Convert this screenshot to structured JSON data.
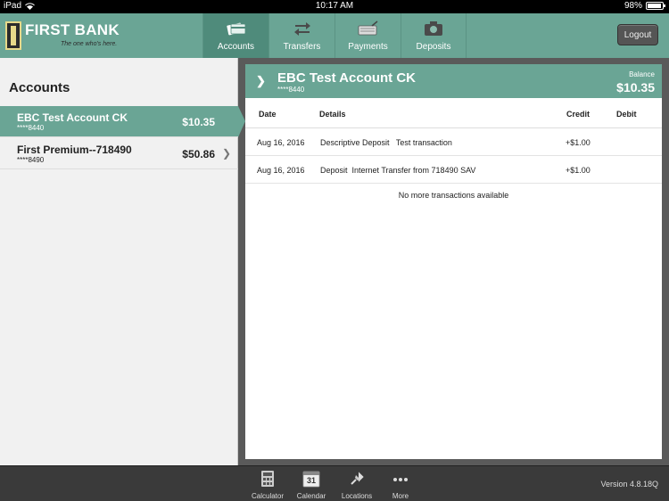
{
  "status_bar": {
    "device": "iPad",
    "time": "10:17 AM",
    "battery": "98%"
  },
  "brand": {
    "name": "FIRST BANK",
    "tagline": "The one who's here."
  },
  "nav": {
    "tabs": [
      {
        "label": "Accounts",
        "icon": "accounts-card-icon",
        "active": true
      },
      {
        "label": "Transfers",
        "icon": "transfer-arrows-icon",
        "active": false
      },
      {
        "label": "Payments",
        "icon": "payments-keyboard-icon",
        "active": false
      },
      {
        "label": "Deposits",
        "icon": "camera-icon",
        "active": false
      }
    ],
    "logout_label": "Logout"
  },
  "accounts_panel": {
    "title": "Accounts",
    "items": [
      {
        "name": "EBC Test Account CK",
        "number": "****8440",
        "balance": "$10.35",
        "selected": true
      },
      {
        "name": "First Premium--718490",
        "number": "****8490",
        "balance": "$50.86",
        "selected": false
      }
    ]
  },
  "detail": {
    "account_name": "EBC Test Account CK",
    "account_number": "****8440",
    "balance_label": "Balance",
    "balance_value": "$10.35",
    "columns": {
      "date": "Date",
      "details": "Details",
      "credit": "Credit",
      "debit": "Debit"
    },
    "transactions": [
      {
        "date": "Aug 16, 2016",
        "details": "Descriptive Deposit   Test transaction",
        "credit": "+$1.00",
        "debit": ""
      },
      {
        "date": "Aug 16, 2016",
        "details": "Deposit  Internet Transfer from 718490 SAV",
        "credit": "+$1.00",
        "debit": ""
      }
    ],
    "no_more_text": "No more transactions available"
  },
  "bottom_bar": {
    "tools": [
      {
        "label": "Calculator",
        "icon": "calculator-icon"
      },
      {
        "label": "Calendar",
        "icon": "calendar-icon",
        "day": "31"
      },
      {
        "label": "Locations",
        "icon": "location-pin-icon"
      },
      {
        "label": "More",
        "icon": "more-dots-icon"
      }
    ],
    "version": "Version 4.8.18Q"
  },
  "colors": {
    "accent": "#6aa595",
    "accent_dark": "#4f8b7b",
    "bottom_bar": "#3a3a3a"
  }
}
